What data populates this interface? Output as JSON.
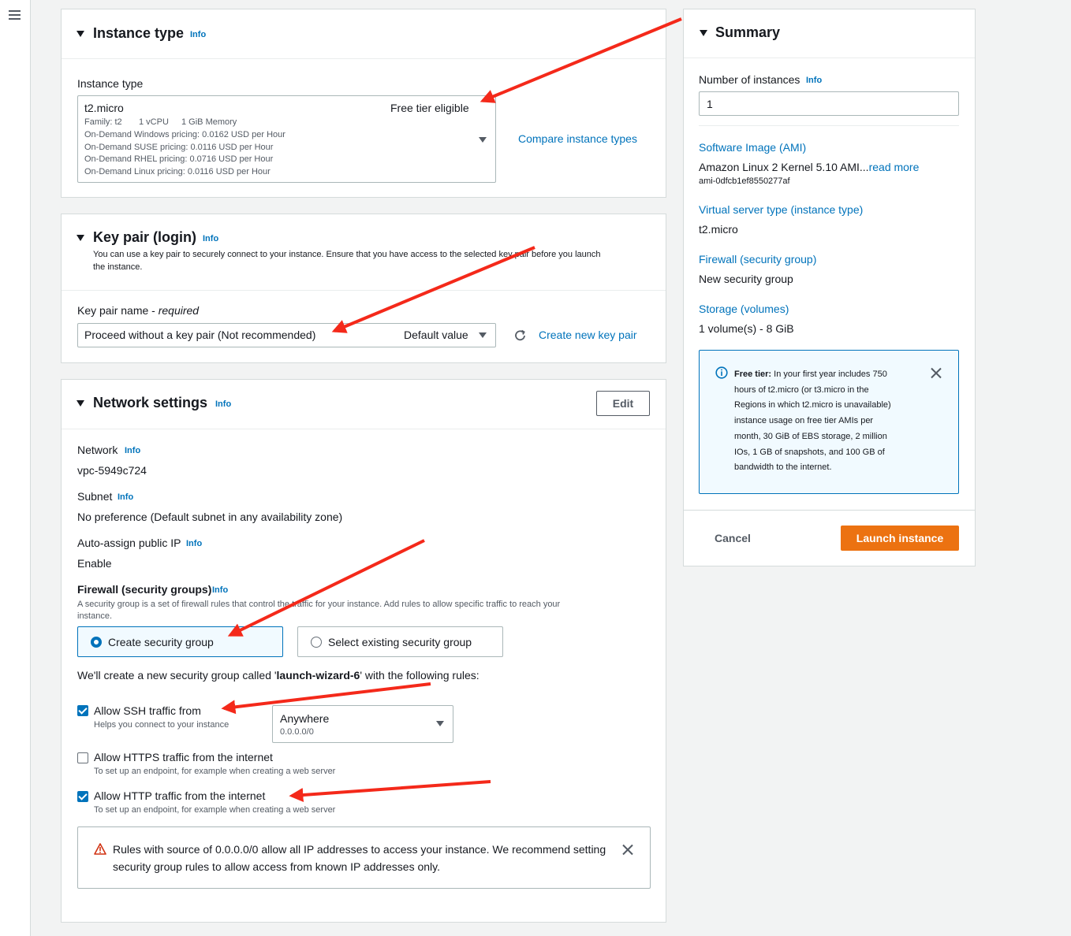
{
  "instance_type": {
    "title": "Instance type",
    "info": "Info",
    "field_label": "Instance type",
    "selected": {
      "name": "t2.micro",
      "badge": "Free tier eligible",
      "family": "Family: t2",
      "vcpu": "1 vCPU",
      "memory": "1 GiB Memory",
      "pricing": [
        "On-Demand Windows pricing: 0.0162 USD per Hour",
        "On-Demand SUSE pricing: 0.0116 USD per Hour",
        "On-Demand RHEL pricing: 0.0716 USD per Hour",
        "On-Demand Linux pricing: 0.0116 USD per Hour"
      ]
    },
    "compare_link": "Compare instance types"
  },
  "key_pair": {
    "title": "Key pair (login)",
    "info": "Info",
    "description_line1": "You can use a key pair to securely connect to your instance. Ensure that you have access to the selected key pair before you launch",
    "description_line2": "the instance.",
    "field_label": "Key pair name - ",
    "field_required": "required",
    "selected": "Proceed without a key pair (Not recommended)",
    "selected_tag": "Default value",
    "create_link": "Create new key pair"
  },
  "network": {
    "title": "Network settings",
    "info": "Info",
    "edit_label": "Edit",
    "network_label": "Network",
    "network_value": "vpc-5949c724",
    "subnet_label": "Subnet",
    "subnet_value": "No preference (Default subnet in any availability zone)",
    "public_ip_label": "Auto-assign public IP",
    "public_ip_value": "Enable",
    "firewall_label": "Firewall (security groups)",
    "firewall_desc_line1": "A security group is a set of firewall rules that control the traffic for your instance. Add rules to allow specific traffic to reach your",
    "firewall_desc_line2": "instance.",
    "option_create": "Create security group",
    "option_existing": "Select existing security group",
    "create_note_prefix": "We'll create a new security group called '",
    "create_note_name": "launch-wizard-6",
    "create_note_suffix": "' with the following rules:",
    "ssh_label": "Allow SSH traffic from",
    "ssh_help": "Helps you connect to your instance",
    "ssh_source": "Anywhere",
    "ssh_source_cidr": "0.0.0.0/0",
    "https_label": "Allow HTTPS traffic from the internet",
    "https_help": "To set up an endpoint, for example when creating a web server",
    "http_label": "Allow HTTP traffic from the internet",
    "http_help": "To set up an endpoint, for example when creating a web server",
    "warning_line1": "Rules with source of 0.0.0.0/0 allow all IP addresses to access your instance. We recommend setting",
    "warning_line2": "security group rules to allow access from known IP addresses only."
  },
  "summary": {
    "title": "Summary",
    "instances_label": "Number of instances",
    "info": "Info",
    "instances_value": "1",
    "ami_label": "Software Image (AMI)",
    "ami_value": "Amazon Linux 2 Kernel 5.10 AMI...",
    "ami_read_more": "read more",
    "ami_id": "ami-0dfcb1ef8550277af",
    "server_type_label": "Virtual server type (instance type)",
    "server_type_value": "t2.micro",
    "firewall_label": "Firewall (security group)",
    "firewall_value": "New security group",
    "storage_label": "Storage (volumes)",
    "storage_value": "1 volume(s) - 8 GiB",
    "free_tier_title": "Free tier:",
    "free_tier_lines": [
      "In your first year includes 750",
      "hours of t2.micro (or t3.micro in the",
      "Regions in which t2.micro is unavailable)",
      "instance usage on free tier AMIs per",
      "month, 30 GiB of EBS storage, 2 million",
      "IOs, 1 GB of snapshots, and 100 GB of",
      "bandwidth to the internet."
    ],
    "cancel_label": "Cancel",
    "launch_label": "Launch instance"
  },
  "colors": {
    "link": "#0073bb",
    "launch": "#ec7211",
    "annotation_arrow": "#f4291a",
    "warning": "#d13212"
  }
}
